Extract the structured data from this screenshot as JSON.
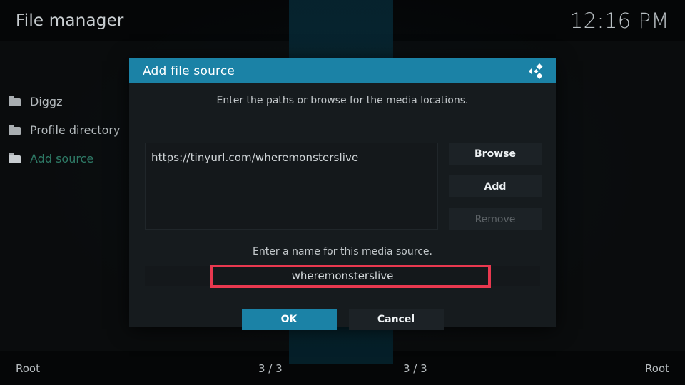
{
  "app": {
    "title": "File manager",
    "clock": "12:16 PM"
  },
  "sidebar": {
    "items": [
      {
        "label": "Diggz",
        "icon": "folder-icon",
        "selected": false
      },
      {
        "label": "Profile directory",
        "icon": "folder-icon",
        "selected": false
      },
      {
        "label": "Add source",
        "icon": "folder-icon",
        "selected": true
      }
    ]
  },
  "footer": {
    "left_label": "Root",
    "left_count": "3 / 3",
    "right_count": "3 / 3",
    "right_label": "Root"
  },
  "dialog": {
    "title": "Add file source",
    "logo_icon": "kodi-logo-icon",
    "path_hint": "Enter the paths or browse for the media locations.",
    "paths": [
      "https://tinyurl.com/wheremonsterslive"
    ],
    "buttons": {
      "browse": "Browse",
      "add": "Add",
      "remove": "Remove"
    },
    "name_hint": "Enter a name for this media source.",
    "name_value": "wheremonsterslive",
    "name_placeholder": "wheremonsterslive",
    "ok": "OK",
    "cancel": "Cancel"
  },
  "colors": {
    "accent": "#1b82a6",
    "highlight_box": "#e8384f",
    "selected_item": "#2e7a66",
    "dialog_bg": "#161b1e"
  }
}
